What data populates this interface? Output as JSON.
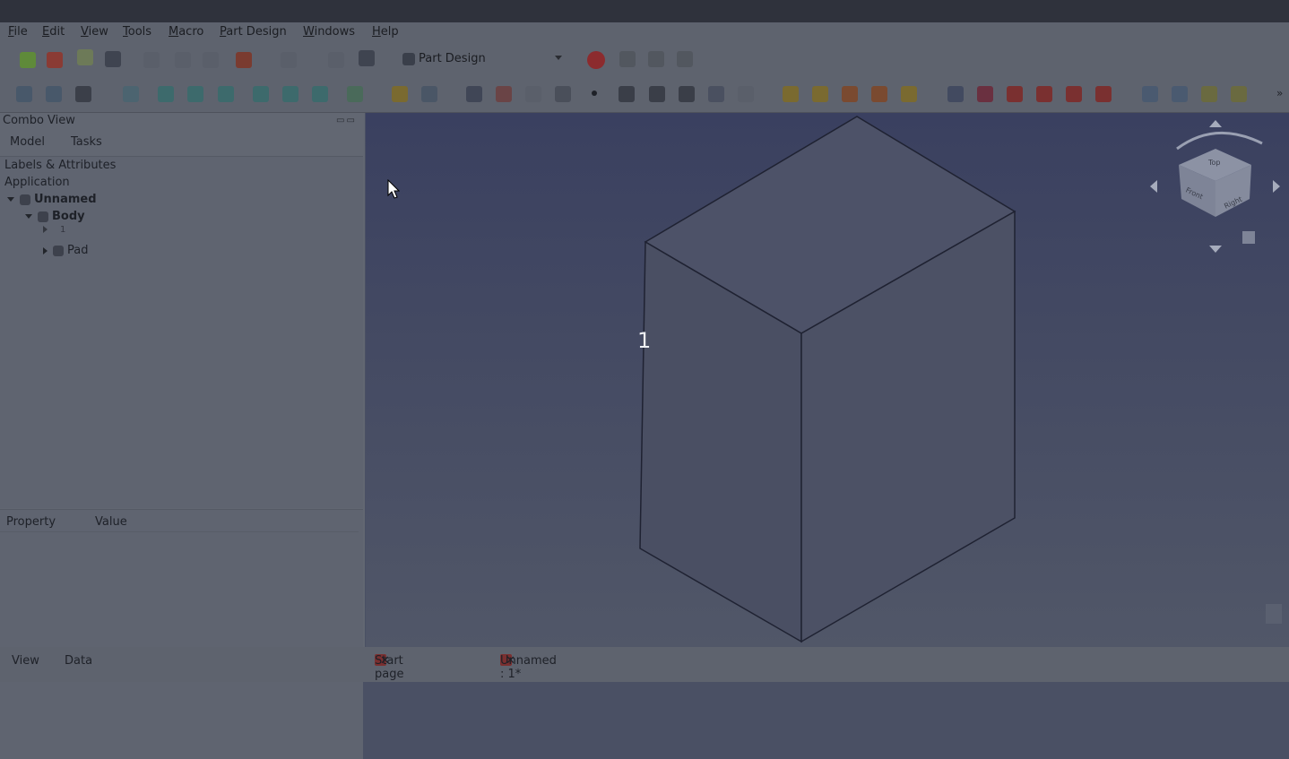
{
  "menu": [
    "File",
    "Edit",
    "View",
    "Tools",
    "Macro",
    "Part Design",
    "Windows",
    "Help"
  ],
  "toolbar": {
    "workbench_label": "Part Design"
  },
  "combo_view": {
    "title": "Combo View",
    "tabs": [
      "Model",
      "Tasks"
    ],
    "tree": {
      "section_label": "Labels & Attributes",
      "application_label": "Application",
      "document": "Unnamed",
      "body": "Body",
      "children": [
        "1",
        "Pad"
      ]
    },
    "property_headers": [
      "Property",
      "Value"
    ]
  },
  "bottom_tabs": [
    "View",
    "Data"
  ],
  "document_tabs": [
    "Start page",
    "Unnamed : 1*"
  ],
  "viewport": {
    "overlay_number": "1",
    "navcube_faces": [
      "Top",
      "Front",
      "Right"
    ]
  },
  "colors": {
    "menubar_bg": "#5e636e",
    "viewport_top": "#3a4060",
    "viewport_bottom": "#515768",
    "cube_edge": "#1f2232",
    "record_button": "#8c2b2e"
  }
}
